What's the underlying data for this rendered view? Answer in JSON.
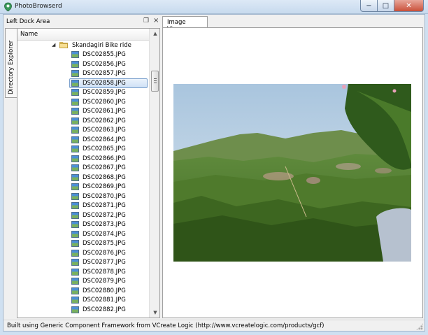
{
  "window": {
    "title": "PhotoBrowserd",
    "minimize_glyph": "−",
    "maximize_glyph": "□",
    "close_glyph": "✕"
  },
  "dock": {
    "title": "Left Dock Area",
    "float_glyph": "❐",
    "close_glyph": "×",
    "side_tab": "Directory Explorer"
  },
  "tree": {
    "column_header": "Name",
    "folder": {
      "name": "Skandagiri Bike ride",
      "expanded": true,
      "icon": "folder-icon"
    },
    "file_icon": "image-file-icon",
    "selected_index": 3,
    "files": [
      "DSC02855.JPG",
      "DSC02856.JPG",
      "DSC02857.JPG",
      "DSC02858.JPG",
      "DSC02859.JPG",
      "DSC02860.JPG",
      "DSC02861.JPG",
      "DSC02862.JPG",
      "DSC02863.JPG",
      "DSC02864.JPG",
      "DSC02865.JPG",
      "DSC02866.JPG",
      "DSC02867.JPG",
      "DSC02868.JPG",
      "DSC02869.JPG",
      "DSC02870.JPG",
      "DSC02871.JPG",
      "DSC02872.JPG",
      "DSC02873.JPG",
      "DSC02874.JPG",
      "DSC02875.JPG",
      "DSC02876.JPG",
      "DSC02877.JPG",
      "DSC02878.JPG",
      "DSC02879.JPG",
      "DSC02880.JPG",
      "DSC02881.JPG",
      "DSC02882.JPG"
    ]
  },
  "viewer": {
    "tab_label": "Image Viewer"
  },
  "statusbar": {
    "text": "Built using Generic Component Framework from VCreate Logic (http://www.vcreatelogic.com/products/gcf)"
  },
  "colors": {
    "selection_border": "#7da2ce",
    "titlebar": "#c7daee",
    "close_button": "#c9503a"
  }
}
